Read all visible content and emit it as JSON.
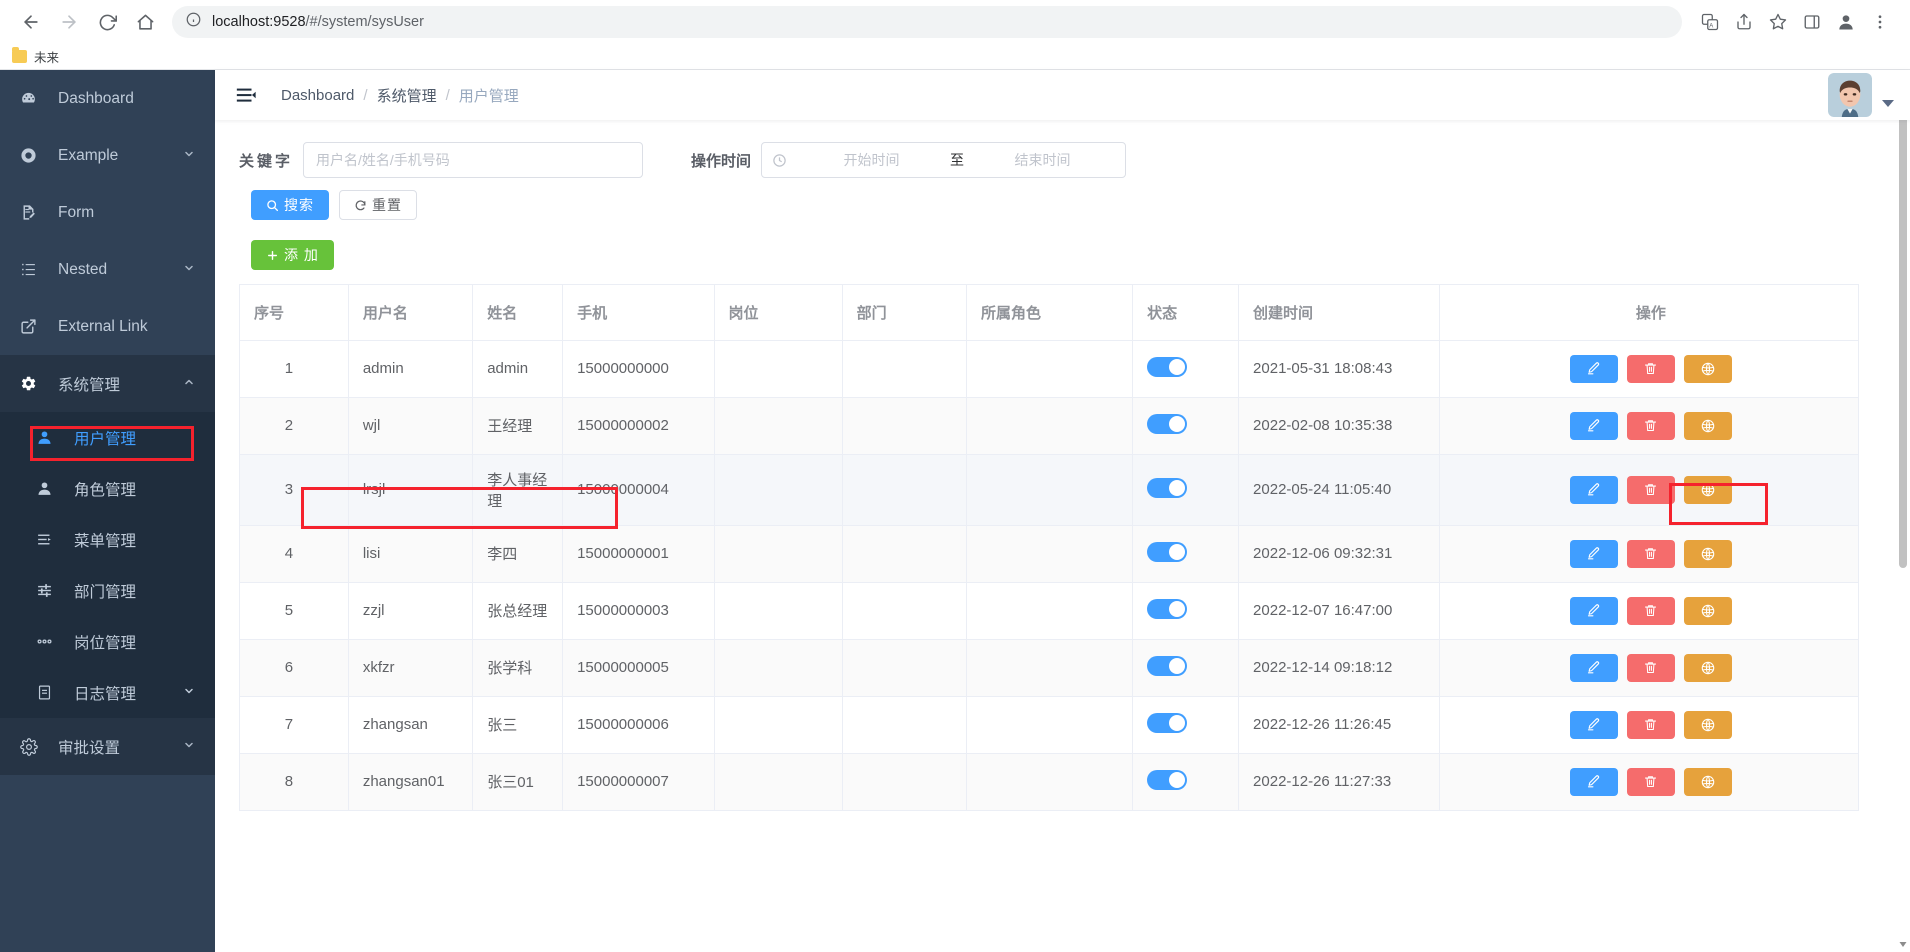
{
  "browser": {
    "url_host": "localhost:9528",
    "url_path": "/#/system/sysUser",
    "bookmark_label": "未来",
    "icons": {
      "back": "back-arrow-icon",
      "forward": "forward-arrow-icon",
      "reload": "reload-icon",
      "home": "home-icon",
      "info": "site-info-icon",
      "translate": "translate-icon",
      "share": "share-icon",
      "bookmark_star": "star-icon",
      "sidepanel": "side-panel-icon",
      "profile": "profile-icon",
      "menu": "kebab-menu-icon"
    }
  },
  "sidebar": {
    "items": [
      {
        "label": "Dashboard",
        "icon": "dashboard-icon",
        "has_arrow": false
      },
      {
        "label": "Example",
        "icon": "example-icon",
        "has_arrow": true
      },
      {
        "label": "Form",
        "icon": "form-icon",
        "has_arrow": false
      },
      {
        "label": "Nested",
        "icon": "nested-list-icon",
        "has_arrow": true
      },
      {
        "label": "External Link",
        "icon": "external-link-icon",
        "has_arrow": false
      },
      {
        "label": "系统管理",
        "icon": "gear-icon",
        "has_arrow": true
      }
    ],
    "submenu": [
      {
        "label": "用户管理",
        "icon": "user-filled-icon",
        "selected": true
      },
      {
        "label": "角色管理",
        "icon": "user-icon",
        "selected": false
      },
      {
        "label": "菜单管理",
        "icon": "menu-list-icon",
        "selected": false
      },
      {
        "label": "部门管理",
        "icon": "sliders-icon",
        "selected": false
      },
      {
        "label": "岗位管理",
        "icon": "ellipsis-icon",
        "selected": false
      },
      {
        "label": "日志管理",
        "icon": "document-icon",
        "selected": false,
        "has_arrow": true
      }
    ],
    "footer_item": {
      "label": "审批设置",
      "icon": "gear-outline-icon",
      "has_arrow": true
    }
  },
  "navbar": {
    "hamburger_icon": "collapse-menu-icon",
    "breadcrumb": [
      {
        "label": "Dashboard",
        "current": false
      },
      {
        "label": "系统管理",
        "current": false
      },
      {
        "label": "用户管理",
        "current": true
      }
    ],
    "separator": "/",
    "avatar_icon": "user-avatar",
    "caret_icon": "chevron-down-icon"
  },
  "search_form": {
    "keyword_label": "关键字",
    "keyword_placeholder": "用户名/姓名/手机号码",
    "keyword_value": "",
    "time_label": "操作时间",
    "time_icon": "clock-icon",
    "start_placeholder": "开始时间",
    "range_separator": "至",
    "end_placeholder": "结束时间",
    "buttons": [
      {
        "label": "搜索",
        "icon": "search-icon",
        "style": "primary"
      },
      {
        "label": "重置",
        "icon": "refresh-icon",
        "style": "default"
      },
      {
        "label": "添 加",
        "icon": "plus-icon",
        "style": "success"
      }
    ]
  },
  "table": {
    "columns": [
      "序号",
      "用户名",
      "姓名",
      "手机",
      "岗位",
      "部门",
      "所属角色",
      "状态",
      "创建时间",
      "操作"
    ],
    "rows": [
      {
        "seq": "1",
        "username": "admin",
        "name": "admin",
        "phone": "15000000000",
        "post": "",
        "dept": "",
        "role": "",
        "status": true,
        "created": "2021-05-31 18:08:43"
      },
      {
        "seq": "2",
        "username": "wjl",
        "name": "王经理",
        "phone": "15000000002",
        "post": "",
        "dept": "",
        "role": "",
        "status": true,
        "created": "2022-02-08 10:35:38"
      },
      {
        "seq": "3",
        "username": "lrsjl",
        "name": "李人事经理",
        "phone": "15000000004",
        "post": "",
        "dept": "",
        "role": "",
        "status": true,
        "created": "2022-05-24 11:05:40"
      },
      {
        "seq": "4",
        "username": "lisi",
        "name": "李四",
        "phone": "15000000001",
        "post": "",
        "dept": "",
        "role": "",
        "status": true,
        "created": "2022-12-06 09:32:31"
      },
      {
        "seq": "5",
        "username": "zzjl",
        "name": "张总经理",
        "phone": "15000000003",
        "post": "",
        "dept": "",
        "role": "",
        "status": true,
        "created": "2022-12-07 16:47:00"
      },
      {
        "seq": "6",
        "username": "xkfzr",
        "name": "张学科",
        "phone": "15000000005",
        "post": "",
        "dept": "",
        "role": "",
        "status": true,
        "created": "2022-12-14 09:18:12"
      },
      {
        "seq": "7",
        "username": "zhangsan",
        "name": "张三",
        "phone": "15000000006",
        "post": "",
        "dept": "",
        "role": "",
        "status": true,
        "created": "2022-12-26 11:26:45"
      },
      {
        "seq": "8",
        "username": "zhangsan01",
        "name": "张三01",
        "phone": "15000000007",
        "post": "",
        "dept": "",
        "role": "",
        "status": true,
        "created": "2022-12-26 11:27:33"
      }
    ],
    "row_actions": [
      {
        "name": "edit-button",
        "icon": "pencil-icon",
        "color": "#409eff"
      },
      {
        "name": "delete-button",
        "icon": "trash-icon",
        "color": "#f56c6c"
      },
      {
        "name": "permission-button",
        "icon": "globe-icon",
        "color": "#e6a23c"
      }
    ]
  },
  "annotations": {
    "highlight_color": "#f5222d",
    "boxes": [
      "sidebar-item-user-management",
      "row-4-identity-cells",
      "row-4-permission-button"
    ]
  }
}
